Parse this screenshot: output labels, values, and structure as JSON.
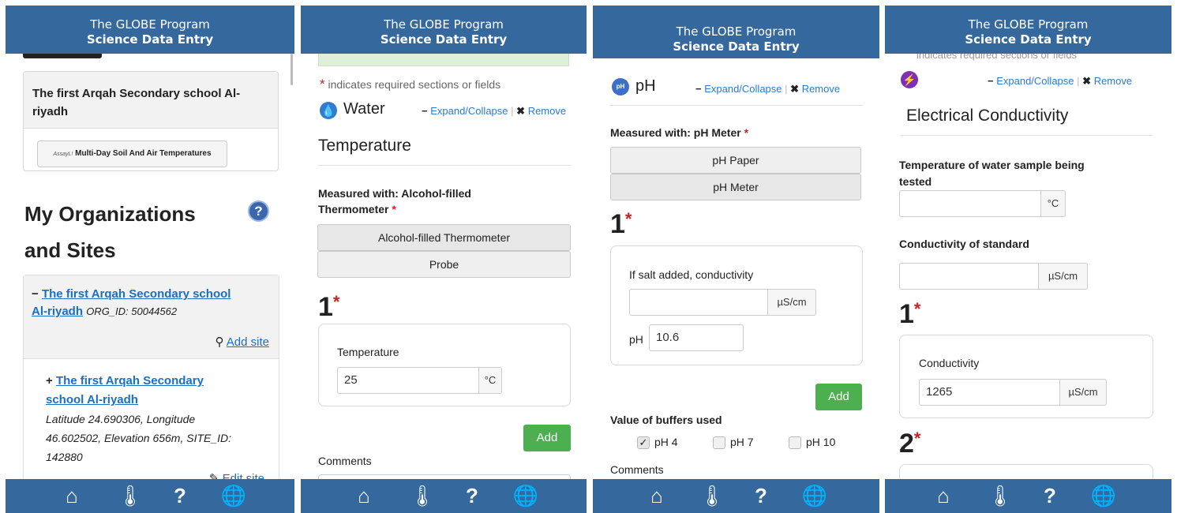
{
  "header": {
    "line1": "The GLOBE Program",
    "line2": "Science Data Entry"
  },
  "panel1": {
    "school_card_title": "The first Arqah Secondary school Al-riyadh",
    "protocol_button_logo": "AssayL!",
    "protocol_button_label": "Multi-Day Soil And Air Temperatures",
    "section_title_line1": "My Organizations",
    "section_title_line2": "and Sites",
    "org_link_line1": "The first Arqah Secondary school",
    "org_link_line2": "Al-riyadh",
    "org_id": "ORG_ID: 50044562",
    "add_site": "Add site",
    "site_link_line1": "The first Arqah Secondary",
    "site_link_line2": "school Al-riyadh",
    "site_details_line1": "Latitude 24.690306, Longitude",
    "site_details_line2": "46.602502, Elevation 656m, SITE_ID:",
    "site_details_line3": "142880",
    "edit_site": "Edit site"
  },
  "panel2": {
    "required_note": "indicates required sections or fields",
    "protocol_title": "Water",
    "expand_collapse": "Expand/Collapse",
    "remove": "Remove",
    "section_title": "Temperature",
    "measured_with_line1": "Measured with: Alcohol-filled",
    "measured_with_line2": "Thermometer",
    "options": [
      "Alcohol-filled Thermometer",
      "Probe"
    ],
    "entry_number": "1",
    "field_label": "Temperature",
    "field_value": "25",
    "field_unit": "°C",
    "add_button": "Add",
    "comments_label": "Comments"
  },
  "panel3": {
    "protocol_title": "pH",
    "icon_text": "pH",
    "expand_collapse": "Expand/Collapse",
    "remove": "Remove",
    "measured_with": "Measured with: pH Meter",
    "options": [
      "pH Paper",
      "pH Meter"
    ],
    "entry_number": "1",
    "salt_label": "If salt added, conductivity",
    "salt_value": "",
    "salt_unit": "µS/cm",
    "ph_label": "pH",
    "ph_value": "10.6",
    "add_button": "Add",
    "buffers_label": "Value of buffers used",
    "buffers": [
      {
        "label": "pH 4",
        "checked": true
      },
      {
        "label": "pH 7",
        "checked": false
      },
      {
        "label": "pH 10",
        "checked": false
      }
    ],
    "comments_label": "Comments"
  },
  "panel4": {
    "top_cut_text": "indicates required sections or fields",
    "expand_collapse": "Expand/Collapse",
    "remove": "Remove",
    "section_title": "Electrical Conductivity",
    "water_temp_line1": "Temperature of water sample being",
    "water_temp_line2": "tested",
    "water_temp_value": "",
    "water_temp_unit": "°C",
    "standard_label": "Conductivity of standard",
    "standard_value": "",
    "standard_unit": "µS/cm",
    "entry1_number": "1",
    "conductivity_label": "Conductivity",
    "conductivity_value": "1265",
    "conductivity_unit": "µS/cm",
    "entry2_number": "2"
  },
  "footer_icons": [
    "home-icon",
    "thermometer-icon",
    "help-icon",
    "globe-icon"
  ],
  "colors": {
    "header": "#35689d",
    "add_button": "#4caf50",
    "link": "#1a6fc4",
    "required": "#cc2222"
  }
}
